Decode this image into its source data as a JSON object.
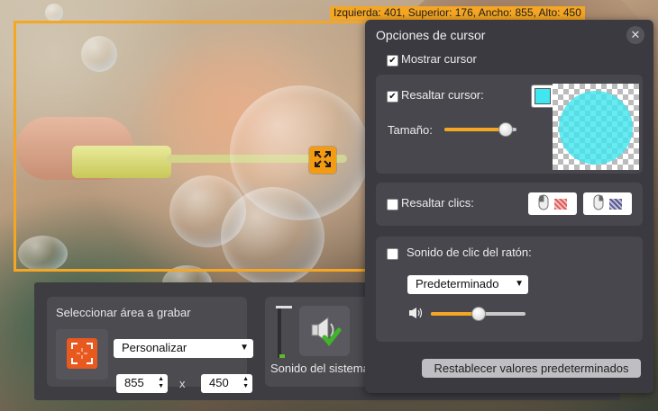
{
  "overlay": {
    "dimensions_label": "Izquierda: 401, Superior: 176, Ancho: 855, Alto: 450"
  },
  "record_bar": {
    "area_title": "Seleccionar área a grabar",
    "preset_value": "Personalizar",
    "width_value": "855",
    "times_symbol": "x",
    "height_value": "450",
    "sound_label": "Sonido del sistema"
  },
  "cursor_panel": {
    "title": "Opciones de cursor",
    "show_cursor_label": "Mostrar cursor",
    "show_cursor_checked": true,
    "highlight_cursor_label": "Resaltar cursor:",
    "highlight_cursor_checked": true,
    "highlight_color": "#40e6f0",
    "size_label": "Tamaño:",
    "size_level": 0.85,
    "highlight_clicks_label": "Resaltar clics:",
    "highlight_clicks_checked": false,
    "click_sound_label": "Sonido de clic del ratón:",
    "click_sound_checked": false,
    "sound_option": "Predeterminado",
    "volume_level": 0.5,
    "reset_label": "Restablecer valores predeterminados"
  },
  "colors": {
    "accent": "#f5a623",
    "panel_bg": "#3b3a40",
    "section_bg": "#48474d"
  }
}
